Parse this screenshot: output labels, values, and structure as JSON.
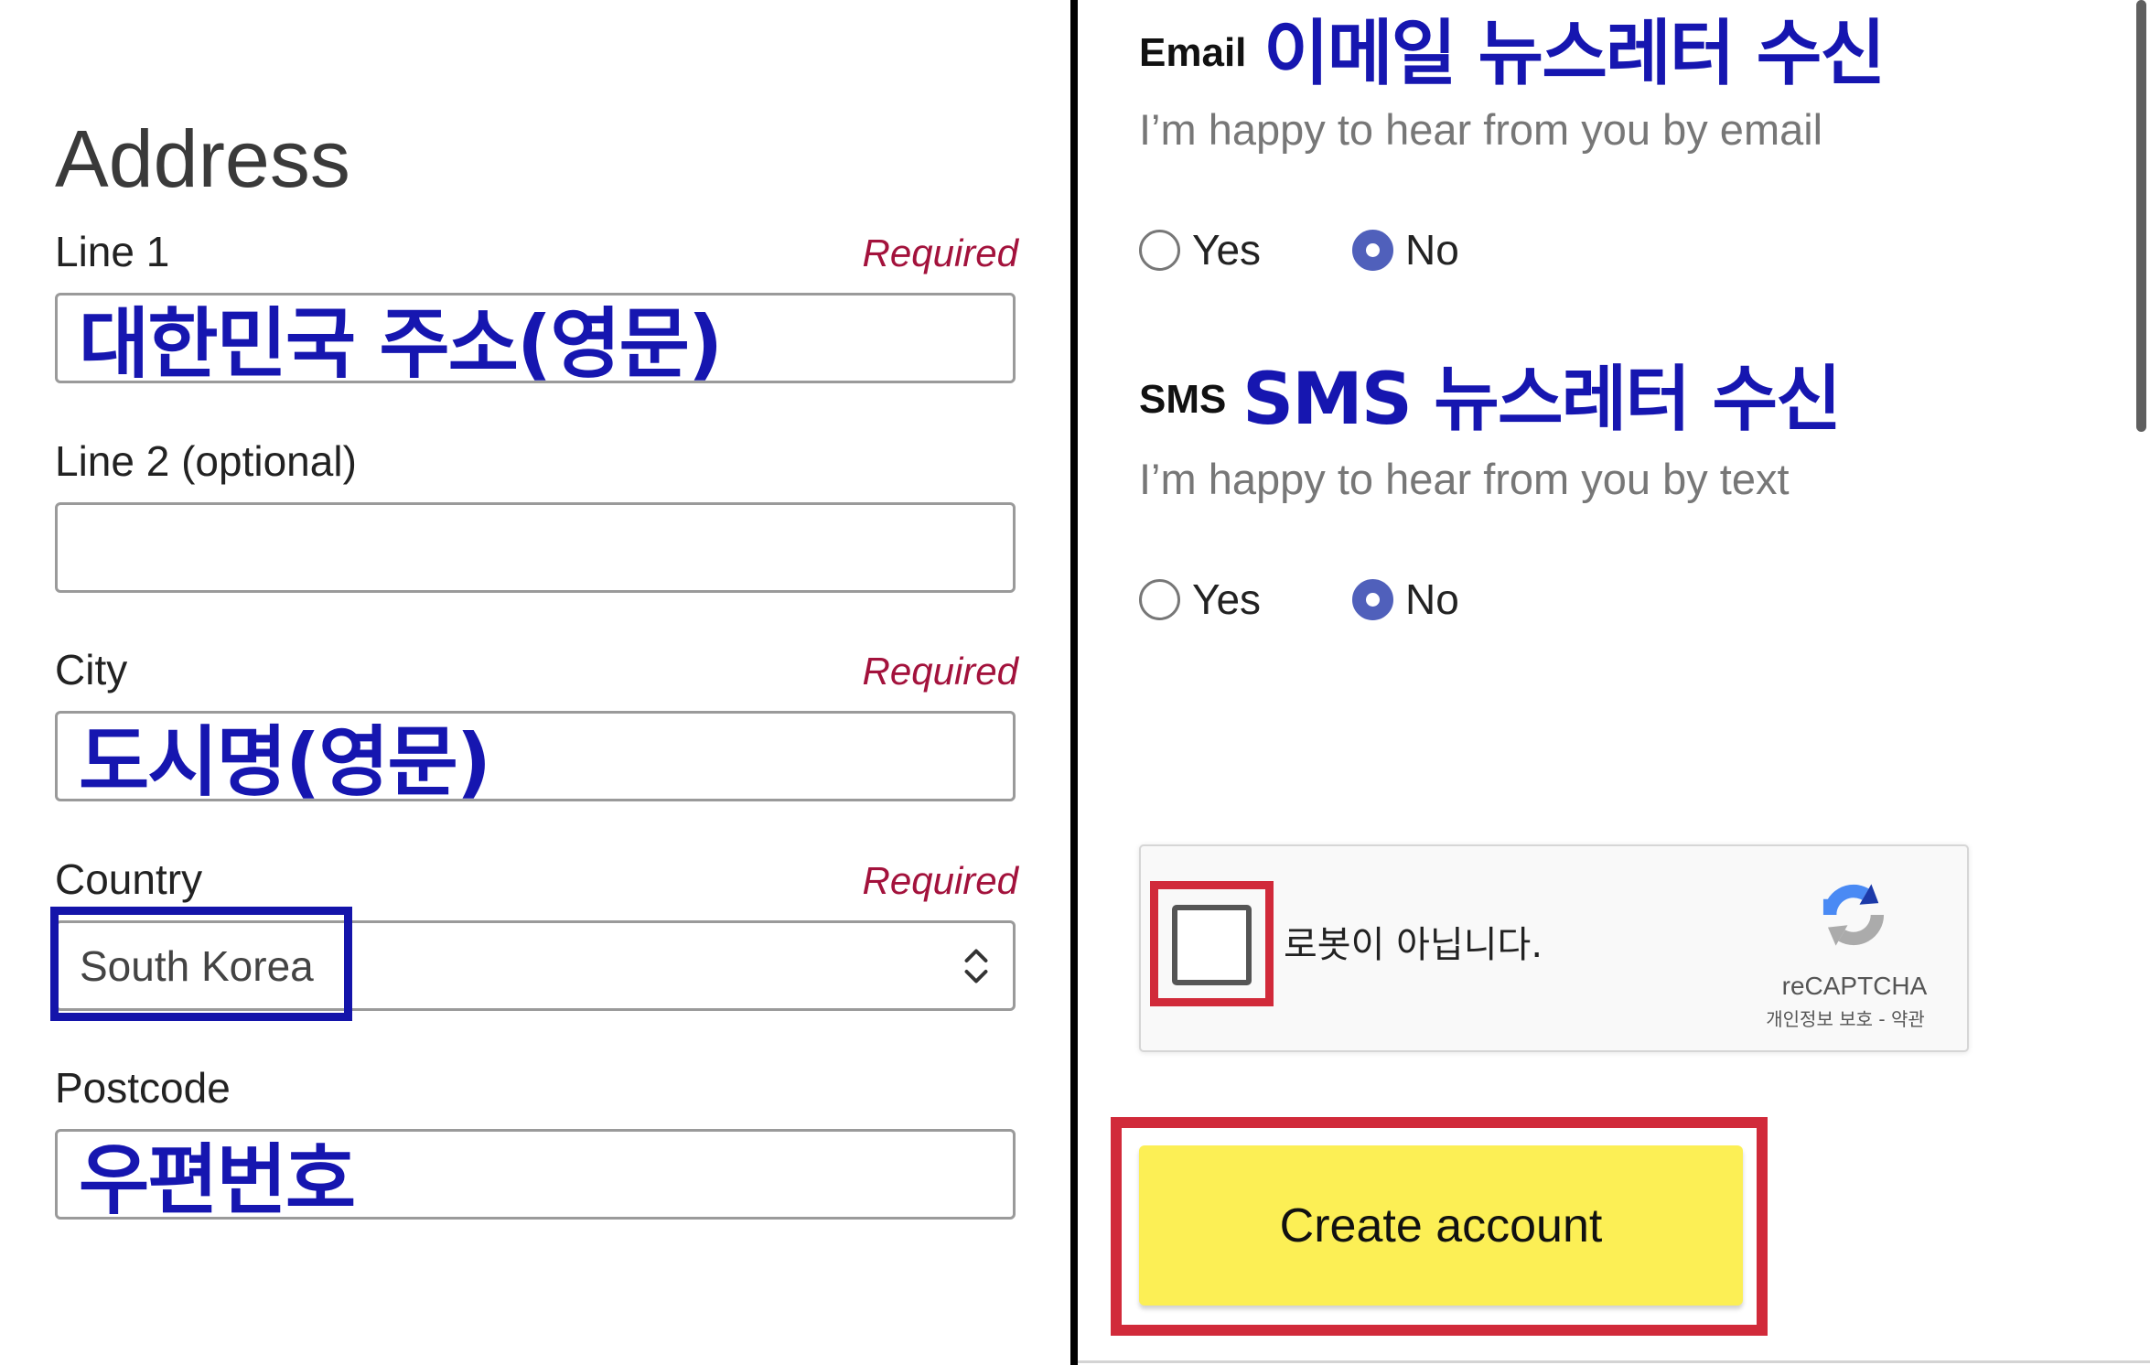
{
  "address": {
    "heading": "Address",
    "line1": {
      "label": "Line 1",
      "required": "Required",
      "value": "대한민국 주소(영문)"
    },
    "line2": {
      "label": "Line 2 (optional)",
      "value": ""
    },
    "city": {
      "label": "City",
      "required": "Required",
      "value": "도시명(영문)"
    },
    "country": {
      "label": "Country",
      "required": "Required",
      "selected": "South Korea",
      "icon": "chevron-up-down-icon"
    },
    "postcode": {
      "label": "Postcode",
      "value": "우편번호"
    }
  },
  "newsletter": {
    "email": {
      "tag": "Email",
      "annotation": "이메일 뉴스레터 수신",
      "description": "I’m happy to hear from you by email",
      "options": [
        "Yes",
        "No"
      ],
      "selected": "No"
    },
    "sms": {
      "tag": "SMS",
      "annotation": "SMS 뉴스레터 수신",
      "description": "I’m happy to hear from you by text",
      "options": [
        "Yes",
        "No"
      ],
      "selected": "No"
    }
  },
  "recaptcha": {
    "checkbox_label": "로봇이 아닙니다.",
    "brand": "reCAPTCHA",
    "links": "개인정보 보호 - 약관",
    "icon": "recaptcha-logo-icon"
  },
  "submit": {
    "label": "Create account"
  },
  "colors": {
    "annotation_blue": "#1616b0",
    "required": "#a3123c",
    "highlight_red": "#d12a3a",
    "highlight_blue": "#1414aa",
    "button_yellow": "#fcef55",
    "radio_selected": "#5060bb",
    "divider": "#000000"
  }
}
